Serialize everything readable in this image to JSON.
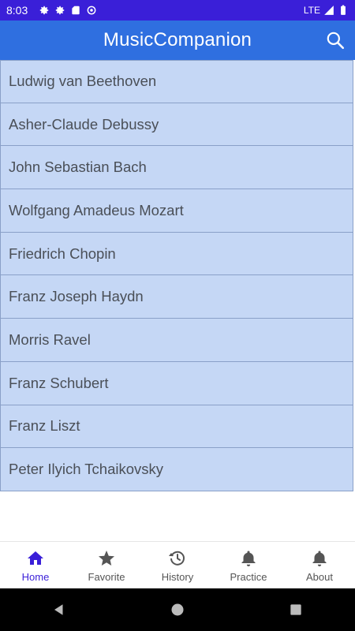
{
  "status_bar": {
    "time": "8:03",
    "network": "LTE"
  },
  "app_bar": {
    "title": "MusicCompanion",
    "search_icon": "search-icon"
  },
  "composers": [
    "Ludwig van Beethoven",
    "Asher-Claude Debussy",
    "John Sebastian Bach",
    "Wolfgang Amadeus Mozart",
    "Friedrich Chopin",
    "Franz Joseph Haydn",
    "Morris Ravel",
    "Franz Schubert",
    "Franz Liszt",
    "Peter Ilyich Tchaikovsky"
  ],
  "bottom_nav": {
    "items": [
      {
        "label": "Home",
        "icon": "home-icon",
        "active": true
      },
      {
        "label": "Favorite",
        "icon": "star-icon",
        "active": false
      },
      {
        "label": "History",
        "icon": "history-icon",
        "active": false
      },
      {
        "label": "Practice",
        "icon": "bell-icon",
        "active": false
      },
      {
        "label": "About",
        "icon": "bell-icon",
        "active": false
      }
    ]
  },
  "colors": {
    "status_bar": "#3a1fd8",
    "app_bar": "#2f6fe0",
    "list_item_bg": "#c5d7f5",
    "active_nav": "#3a1fd8"
  }
}
